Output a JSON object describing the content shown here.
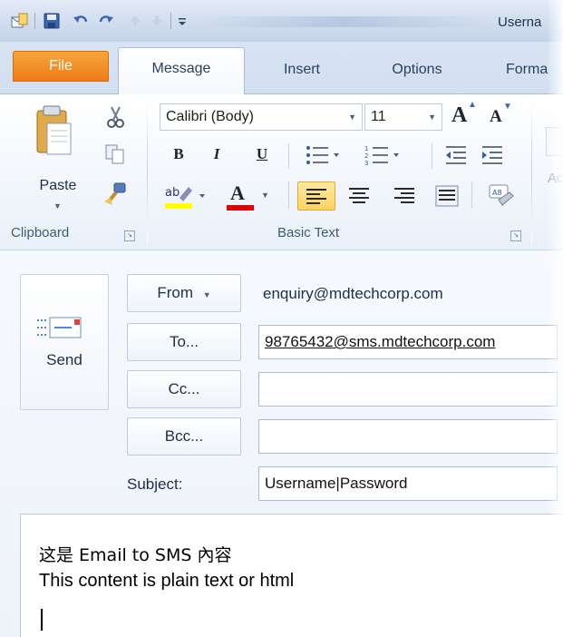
{
  "window": {
    "title": "Userna"
  },
  "qat": {
    "icons": [
      "outlook-icon",
      "save-icon",
      "undo-icon",
      "redo-icon",
      "up-arrow-icon",
      "down-arrow-icon",
      "customize-icon"
    ]
  },
  "tabs": [
    {
      "label": "File"
    },
    {
      "label": "Message"
    },
    {
      "label": "Insert"
    },
    {
      "label": "Options"
    },
    {
      "label": "Forma"
    }
  ],
  "ribbon": {
    "clipboard": {
      "label": "Clipboard",
      "paste": "Paste"
    },
    "basic_text": {
      "label": "Basic Text",
      "font": "Calibri (Body)",
      "size": "11",
      "bold": "B",
      "italic": "I",
      "underline": "U",
      "grow": "A",
      "shrink": "A",
      "font_color": "A"
    },
    "next_group_hint": "Ac"
  },
  "compose": {
    "send": "Send",
    "from_button": "From",
    "from_value": "enquiry@mdtechcorp.com",
    "to_button": "To...",
    "to_value": "98765432@sms.mdtechcorp.com",
    "cc_button": "Cc...",
    "cc_value": "",
    "bcc_button": "Bcc...",
    "bcc_value": "",
    "subject_label": "Subject:",
    "subject_value": "Username|Password",
    "body_lines": [
      "这是 Email to SMS 內容",
      "This content is plain text or html"
    ]
  },
  "colors": {
    "file_tab": "#ee7a18",
    "highlight": "#ffff00",
    "font_color": "#e00000",
    "accent": "#1e395b"
  }
}
